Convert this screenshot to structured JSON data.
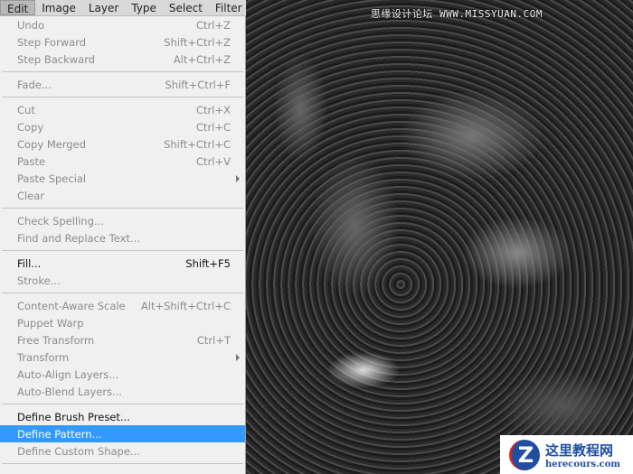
{
  "menubar": [
    "Edit",
    "Image",
    "Layer",
    "Type",
    "Select",
    "Filter"
  ],
  "menu": [
    {
      "label": "Undo",
      "shortcut": "Ctrl+Z",
      "enabled": false
    },
    {
      "label": "Step Forward",
      "shortcut": "Shift+Ctrl+Z",
      "enabled": false
    },
    {
      "label": "Step Backward",
      "shortcut": "Alt+Ctrl+Z",
      "enabled": false
    },
    {
      "sep": true
    },
    {
      "label": "Fade...",
      "shortcut": "Shift+Ctrl+F",
      "enabled": false
    },
    {
      "sep": true
    },
    {
      "label": "Cut",
      "shortcut": "Ctrl+X",
      "enabled": false
    },
    {
      "label": "Copy",
      "shortcut": "Ctrl+C",
      "enabled": false
    },
    {
      "label": "Copy Merged",
      "shortcut": "Shift+Ctrl+C",
      "enabled": false
    },
    {
      "label": "Paste",
      "shortcut": "Ctrl+V",
      "enabled": false
    },
    {
      "label": "Paste Special",
      "shortcut": "",
      "enabled": false,
      "submenu": true
    },
    {
      "label": "Clear",
      "shortcut": "",
      "enabled": false
    },
    {
      "sep": true
    },
    {
      "label": "Check Spelling...",
      "shortcut": "",
      "enabled": false
    },
    {
      "label": "Find and Replace Text...",
      "shortcut": "",
      "enabled": false
    },
    {
      "sep": true
    },
    {
      "label": "Fill...",
      "shortcut": "Shift+F5",
      "enabled": true
    },
    {
      "label": "Stroke...",
      "shortcut": "",
      "enabled": false
    },
    {
      "sep": true
    },
    {
      "label": "Content-Aware Scale",
      "shortcut": "Alt+Shift+Ctrl+C",
      "enabled": false
    },
    {
      "label": "Puppet Warp",
      "shortcut": "",
      "enabled": false
    },
    {
      "label": "Free Transform",
      "shortcut": "Ctrl+T",
      "enabled": false
    },
    {
      "label": "Transform",
      "shortcut": "",
      "enabled": false,
      "submenu": true
    },
    {
      "label": "Auto-Align Layers...",
      "shortcut": "",
      "enabled": false
    },
    {
      "label": "Auto-Blend Layers...",
      "shortcut": "",
      "enabled": false
    },
    {
      "sep": true
    },
    {
      "label": "Define Brush Preset...",
      "shortcut": "",
      "enabled": true
    },
    {
      "label": "Define Pattern...",
      "shortcut": "",
      "enabled": true,
      "highlighted": true
    },
    {
      "label": "Define Custom Shape...",
      "shortcut": "",
      "enabled": false
    },
    {
      "sep": true
    }
  ],
  "watermark": "思缘设计论坛 WWW.MISSYUAN.COM",
  "logo": {
    "icon": "Z",
    "title": "这里教程网",
    "url": "herecours.com"
  }
}
